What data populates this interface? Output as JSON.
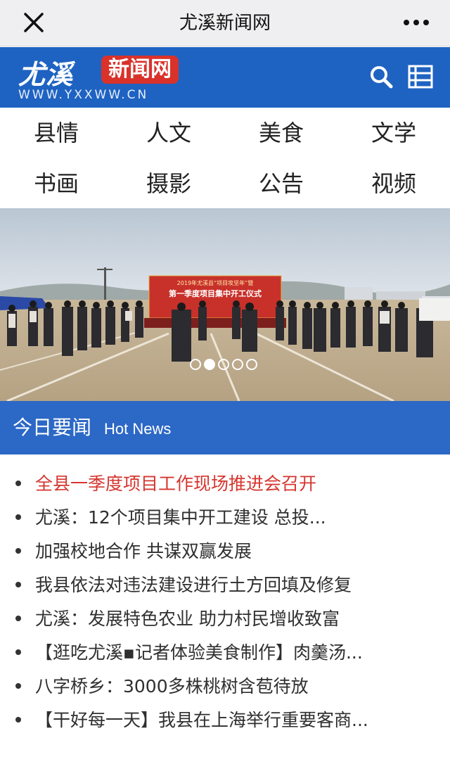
{
  "topbar": {
    "title": "尤溪新闻网",
    "close_icon": "close-icon",
    "more_icon": "more-dots-icon"
  },
  "site_header": {
    "logo_left": "尤溪",
    "logo_right": "新闻网",
    "logo_url": "WWW.YXXWW.CN",
    "search_icon": "search-icon",
    "menu_icon": "menu-icon",
    "brand_color": "#1f63c2",
    "logo_red": "#d9322b"
  },
  "categories": [
    {
      "label": "县情"
    },
    {
      "label": "人文"
    },
    {
      "label": "美食"
    },
    {
      "label": "文学"
    },
    {
      "label": "书画"
    },
    {
      "label": "摄影"
    },
    {
      "label": "公告"
    },
    {
      "label": "视频"
    }
  ],
  "banner": {
    "sign_line1": "2019年尤溪县“项目攻坚年”暨",
    "sign_line2": "第一季度项目集中开工仪式",
    "slide_count": 5,
    "active_slide": 2
  },
  "hot_news": {
    "title_cn": "今日要闻",
    "title_en": "Hot News",
    "bar_color": "#2c68c5",
    "highlight_color": "#d5362f",
    "items": [
      {
        "text": "全县一季度项目工作现场推进会召开",
        "highlight": true
      },
      {
        "text": "尤溪：12个项目集中开工建设 总投...",
        "highlight": false
      },
      {
        "text": "加强校地合作 共谋双赢发展",
        "highlight": false
      },
      {
        "text": "我县依法对违法建设进行土方回填及修复",
        "highlight": false
      },
      {
        "text": "尤溪：发展特色农业 助力村民增收致富",
        "highlight": false
      },
      {
        "text": "【逛吃尤溪▪记者体验美食制作】肉羹汤...",
        "highlight": false
      },
      {
        "text": "八字桥乡：3000多株桃树含苞待放",
        "highlight": false
      },
      {
        "text": "【干好每一天】我县在上海举行重要客商...",
        "highlight": false
      }
    ]
  }
}
